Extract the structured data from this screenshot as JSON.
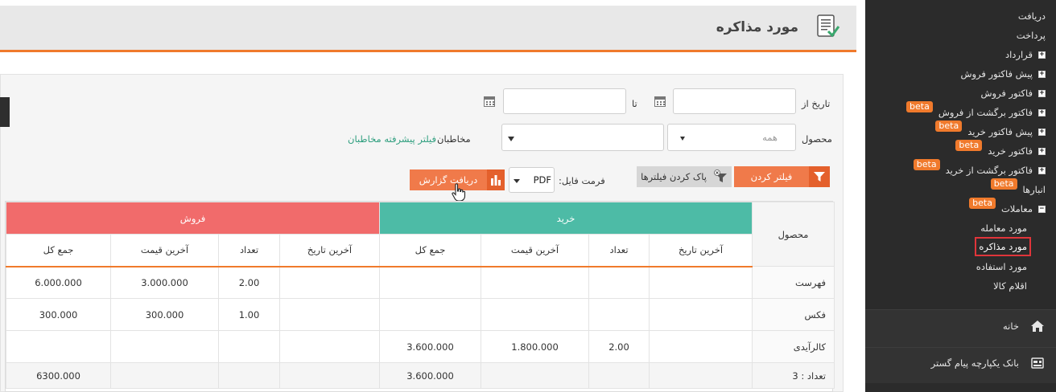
{
  "header": {
    "title": "مورد مذاکره"
  },
  "filters": {
    "date_from_label": "تاریخ از",
    "date_to_label": "تا",
    "date_from_value": "",
    "date_to_value": "",
    "product_label": "محصول",
    "product_value": "همه",
    "contacts_label": "مخاطبان",
    "contacts_link": "فیلتر پیشرفته مخاطبان",
    "filter_button": "فیلتر کردن",
    "clear_button": "پاک کردن فیلترها",
    "format_label": "فرمت فایل:",
    "format_value": "PDF",
    "report_button": "دریافت گزارش"
  },
  "table": {
    "product_header": "محصول",
    "buy_header": "خرید",
    "sell_header": "فروش",
    "columns": [
      "آخرین تاریخ",
      "تعداد",
      "آخرین قیمت",
      "جمع کل"
    ],
    "rows": [
      {
        "product": "فهرست",
        "buy_date": "",
        "buy_qty": "",
        "buy_price": "",
        "buy_total": "",
        "sell_date": "",
        "sell_qty": "2.00",
        "sell_price": "3.000.000",
        "sell_total": "6.000.000"
      },
      {
        "product": "فکس",
        "buy_date": "",
        "buy_qty": "",
        "buy_price": "",
        "buy_total": "",
        "sell_date": "",
        "sell_qty": "1.00",
        "sell_price": "300.000",
        "sell_total": "300.000"
      },
      {
        "product": "کالرآیدی",
        "buy_date": "",
        "buy_qty": "2.00",
        "buy_price": "1.800.000",
        "buy_total": "3.600.000",
        "sell_date": "",
        "sell_qty": "",
        "sell_price": "",
        "sell_total": ""
      }
    ],
    "footer": {
      "count_label": "تعداد : 3",
      "buy_total": "3.600.000",
      "sell_total": "6300.000"
    }
  },
  "sidebar": {
    "items": [
      {
        "label": "دریافت",
        "expandable": false,
        "beta": ""
      },
      {
        "label": "پرداخت",
        "expandable": false,
        "beta": ""
      },
      {
        "label": "قرارداد",
        "expandable": true,
        "beta": ""
      },
      {
        "label": "پیش فاکتور فروش",
        "expandable": true,
        "beta": ""
      },
      {
        "label": "فاکتور فروش",
        "expandable": true,
        "beta": ""
      },
      {
        "label": "فاکتور برگشت از فروش",
        "expandable": true,
        "beta": "beta"
      },
      {
        "label": "پیش فاکتور خرید",
        "expandable": true,
        "beta": "beta"
      },
      {
        "label": "فاکتور خرید",
        "expandable": true,
        "beta": "beta"
      },
      {
        "label": "فاکتور برگشت از خرید",
        "expandable": true,
        "beta": "beta"
      },
      {
        "label": "انبارها",
        "expandable": false,
        "beta": "beta"
      },
      {
        "label": "معاملات",
        "expandable": true,
        "beta": "beta"
      }
    ],
    "sub_items": [
      {
        "label": "مورد معامله"
      },
      {
        "label": "مورد مذاکره"
      },
      {
        "label": "مورد استفاده"
      },
      {
        "label": "اقلام کالا"
      }
    ],
    "home_label": "خانه",
    "bank_label": "بانک یکپارچه پیام گستر"
  },
  "colors": {
    "accent": "#f07a2c",
    "buy": "#4dbba6",
    "sell": "#f16b6b",
    "sidebar": "#2b2b2b"
  }
}
